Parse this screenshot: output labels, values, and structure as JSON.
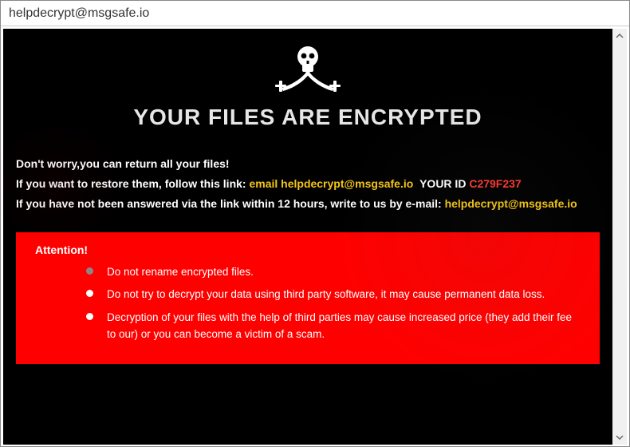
{
  "window": {
    "title": "helpdecrypt@msgsafe.io"
  },
  "icon_name": "skull-swords-icon",
  "headline": "YOUR FILES ARE ENCRYPTED",
  "instructions": {
    "line1": "Don't worry,you can return all your files!",
    "line2_prefix": "If you want to restore them, follow this link:",
    "line2_email_label": "email helpdecrypt@msgsafe.io",
    "line2_id_label": "YOUR ID",
    "line2_id_value": "C279F237",
    "line3_prefix": "If you have not been answered via the link within 12 hours, write to us by e-mail:",
    "line3_email": "helpdecrypt@msgsafe.io"
  },
  "attention": {
    "title": "Attention!",
    "items": [
      "Do not rename encrypted files.",
      "Do not try to decrypt your data using third party software, it may cause permanent data loss.",
      "Decryption of your files with the help of third parties may cause increased price (they add their fee to our) or you can become a victim of a scam."
    ]
  }
}
